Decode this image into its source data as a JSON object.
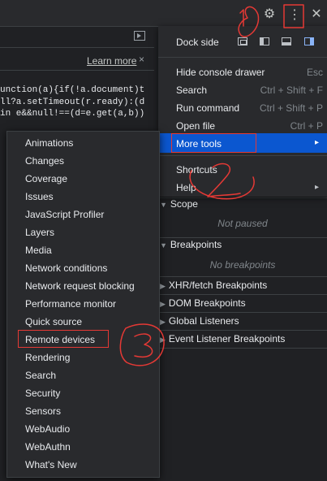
{
  "toolbar": {
    "settings_icon": "gear-icon",
    "customize_icon": "vertical-ellipsis-icon",
    "close_icon": "close-icon",
    "gear_glyph": "⚙",
    "kebab_glyph": "⋮",
    "close_glyph": "✕"
  },
  "editor": {
    "learn_more": "Learn more",
    "learn_close": "×",
    "code_lines": [
      "unction(a){if(!a.document)t",
      "ll?a.setTimeout(r.ready):(d",
      "in e&&null!==(d=e.get(a,b))"
    ]
  },
  "more_menu": {
    "dock_side_label": "Dock side",
    "items": [
      {
        "label": "Hide console drawer",
        "shortcut": "Esc"
      },
      {
        "label": "Search",
        "shortcut": "Ctrl + Shift + F"
      },
      {
        "label": "Run command",
        "shortcut": "Ctrl + Shift + P"
      },
      {
        "label": "Open file",
        "shortcut": "Ctrl + P"
      },
      {
        "label": "More tools",
        "shortcut": "▸"
      },
      {
        "label": "Shortcuts",
        "shortcut": ""
      },
      {
        "label": "Help",
        "shortcut": "▸"
      }
    ]
  },
  "debugger": {
    "scope_title": "Scope",
    "scope_status": "Not paused",
    "breakpoints_title": "Breakpoints",
    "breakpoints_status": "No breakpoints",
    "xhr_title": "XHR/fetch Breakpoints",
    "dom_title": "DOM Breakpoints",
    "global_title": "Global Listeners",
    "event_title": "Event Listener Breakpoints",
    "collapsed_arrow": "▶",
    "expanded_arrow": "▼"
  },
  "more_tools_submenu": {
    "items": [
      "Animations",
      "Changes",
      "Coverage",
      "Issues",
      "JavaScript Profiler",
      "Layers",
      "Media",
      "Network conditions",
      "Network request blocking",
      "Performance monitor",
      "Quick source",
      "Remote devices",
      "Rendering",
      "Search",
      "Security",
      "Sensors",
      "WebAudio",
      "WebAuthn",
      "What's New"
    ],
    "highlighted": "Remote devices"
  },
  "annotations": {
    "color": "#e53935",
    "marks": [
      "1",
      "2",
      "3"
    ]
  },
  "colors": {
    "background": "#202124",
    "menu": "#292a2d",
    "selection": "#0b57d0",
    "annotation": "#e53935",
    "dock_active": "#8ab4f8"
  }
}
